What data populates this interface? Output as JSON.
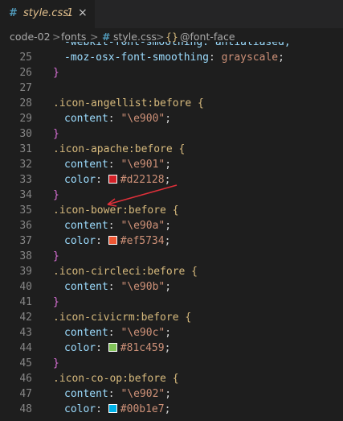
{
  "tab": {
    "icon": "#",
    "name": "style.css",
    "badge": "1",
    "close": "×"
  },
  "breadcrumb": {
    "folder1": "code-02",
    "folder2": "fonts",
    "file_icon": "#",
    "file": "style.css",
    "symbol_icon": "{}",
    "symbol": "@font-face",
    "separator": ">"
  },
  "lines": [
    {
      "n": "25",
      "prop": "-moz-osx-font-smoothing",
      "value": "grayscale"
    },
    {
      "n": "26",
      "text": "}"
    },
    {
      "n": "27",
      "text": ""
    },
    {
      "n": "28",
      "selector": ".icon-angellist:before {"
    },
    {
      "n": "29",
      "prop": "content",
      "str": "\"\\e900\""
    },
    {
      "n": "30",
      "text": "}"
    },
    {
      "n": "31",
      "selector": ".icon-apache:before {"
    },
    {
      "n": "32",
      "prop": "content",
      "str": "\"\\e901\""
    },
    {
      "n": "33",
      "prop": "color",
      "color": "#d22128"
    },
    {
      "n": "34",
      "text": "}"
    },
    {
      "n": "35",
      "selector": ".icon-bower:before {"
    },
    {
      "n": "36",
      "prop": "content",
      "str": "\"\\e90a\""
    },
    {
      "n": "37",
      "prop": "color",
      "color": "#ef5734"
    },
    {
      "n": "38",
      "text": "}"
    },
    {
      "n": "39",
      "selector": ".icon-circleci:before {"
    },
    {
      "n": "40",
      "prop": "content",
      "str": "\"\\e90b\""
    },
    {
      "n": "41",
      "text": "}"
    },
    {
      "n": "42",
      "selector": ".icon-civicrm:before {"
    },
    {
      "n": "43",
      "prop": "content",
      "str": "\"\\e90c\""
    },
    {
      "n": "44",
      "prop": "color",
      "color": "#81c459"
    },
    {
      "n": "45",
      "text": "}"
    },
    {
      "n": "46",
      "selector": ".icon-co-op:before {"
    },
    {
      "n": "47",
      "prop": "content",
      "str": "\"\\e902\""
    },
    {
      "n": "48",
      "prop": "color",
      "color": "#00b1e7"
    }
  ],
  "colors": {
    "editor_bg": "#1e1e1e",
    "tabbar_bg": "#252526",
    "selector": "#d7ba7d",
    "property": "#9cdcfe",
    "string": "#ce9178",
    "annotation_arrow": "#e0303a"
  }
}
